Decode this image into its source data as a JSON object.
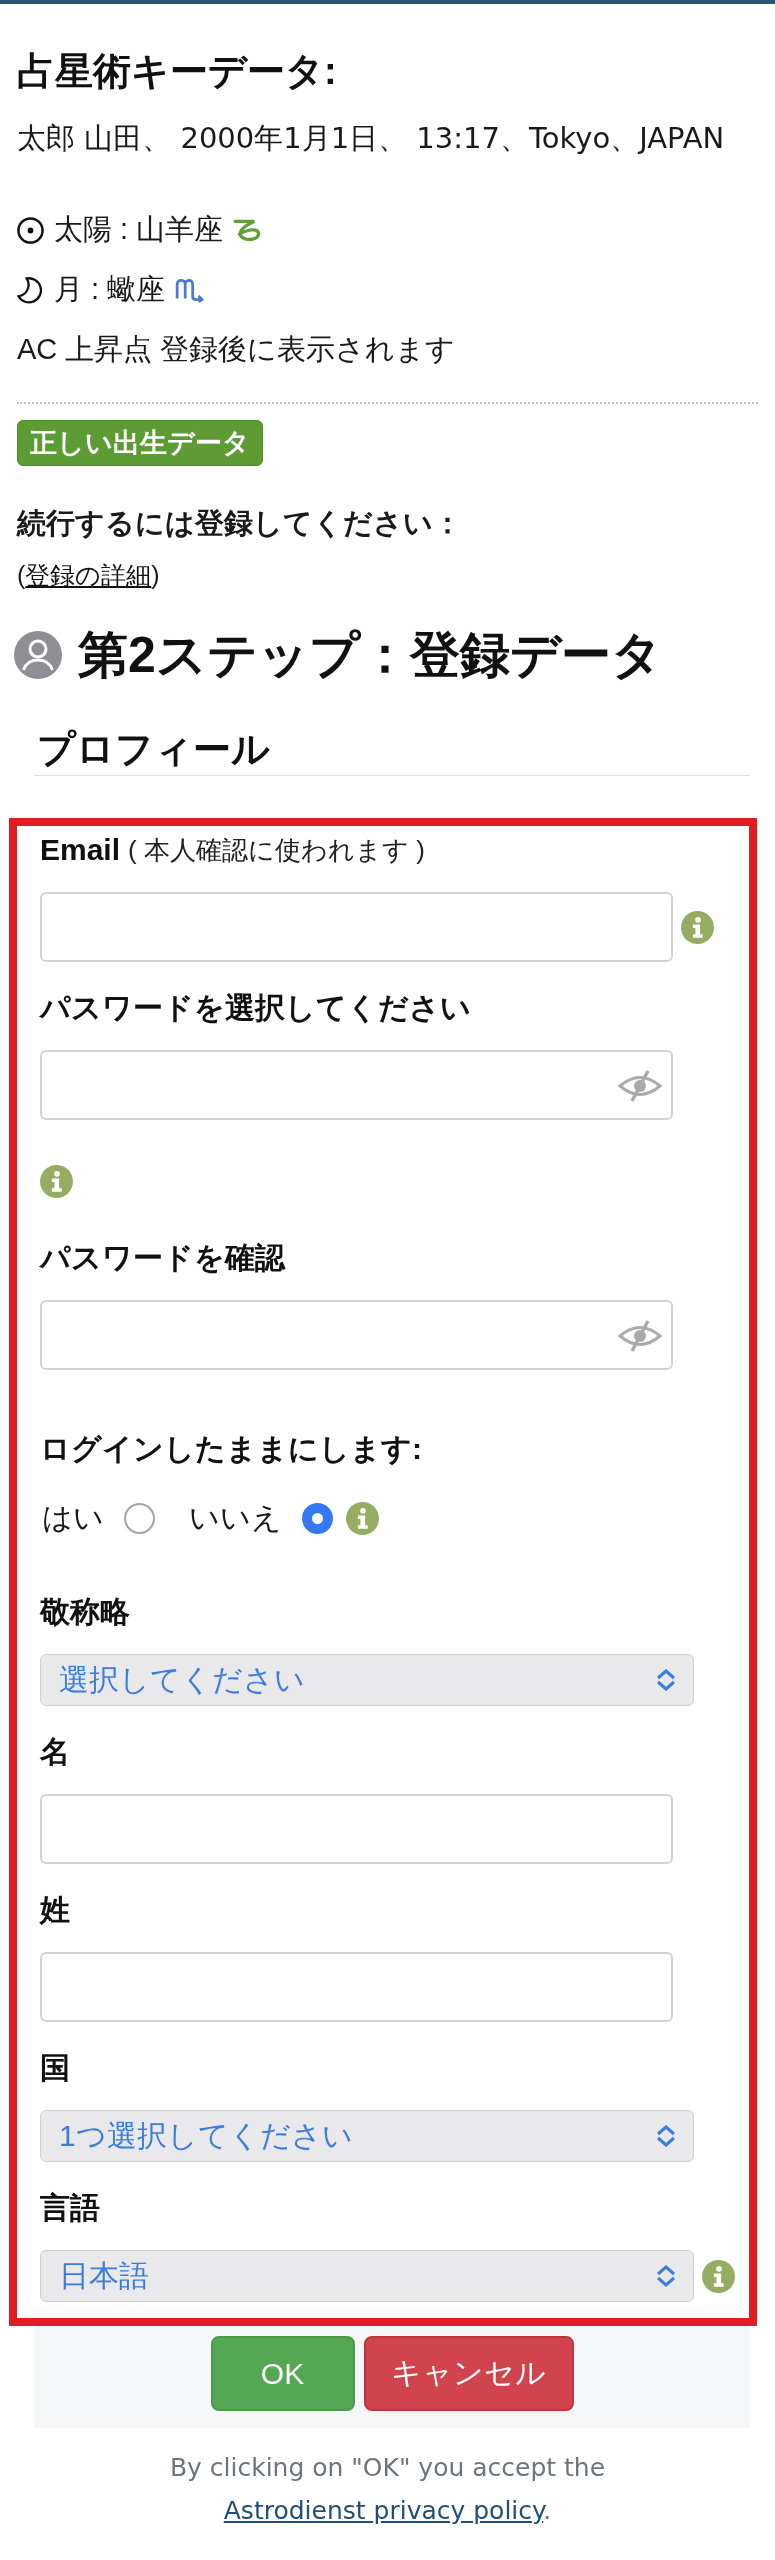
{
  "key_data": {
    "title": "占星術キーデータ:",
    "birth_line": "太郎 山田、 2000年1月1日、 13:17、Tokyo、JAPAN",
    "positions": [
      {
        "kind": "sun",
        "text": "太陽 : 山羊座",
        "sign": {
          "kind": "capricorn",
          "color": "#5f9f3a"
        }
      },
      {
        "kind": "moon",
        "text": "月 : 蠍座",
        "sign": {
          "kind": "scorpio",
          "color": "#4a7bd0"
        }
      }
    ],
    "ascendant": "AC 上昇点 登録後に表示されます"
  },
  "birth_data_button": "正しい出生データ",
  "register_prompt": "続行するには登録してください：",
  "register_details": {
    "open": "(",
    "link": "登録の詳細",
    "close": ")"
  },
  "step_title": "第2ステップ：登録データ",
  "section_title": "プロフィール",
  "form_fields": [
    {
      "kind": "text",
      "label": "Email",
      "note": "( 本人確認に使われます )",
      "info": true
    },
    {
      "kind": "password",
      "label": "パスワードを選択してください",
      "info": true
    },
    {
      "kind": "password",
      "label": "パスワードを確認",
      "info": false
    },
    {
      "kind": "radio",
      "label": "ログインしたままにします:",
      "options": [
        {
          "label": "はい",
          "selected": false
        },
        {
          "label": "いいえ",
          "selected": true
        }
      ],
      "info": true
    },
    {
      "kind": "select",
      "label": "敬称略",
      "value": "選択してください",
      "info": false
    },
    {
      "kind": "text",
      "label": "名",
      "info": false
    },
    {
      "kind": "text",
      "label": "姓",
      "info": false
    },
    {
      "kind": "select",
      "label": "国",
      "value": "1つ選択してください",
      "info": false
    },
    {
      "kind": "select",
      "label": "言語",
      "value": "日本語",
      "info": true
    }
  ],
  "buttons": [
    {
      "kind": "ok",
      "label": "OK"
    },
    {
      "kind": "cancel",
      "label": "キャンセル"
    }
  ],
  "consent": {
    "text": "By clicking on \"OK\" you accept the ",
    "link": "Astrodienst privacy policy",
    "end": "."
  }
}
